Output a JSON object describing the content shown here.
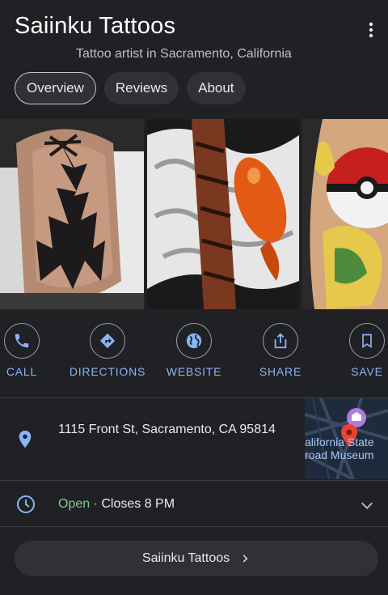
{
  "header": {
    "title": "Saiinku Tattoos",
    "subtitle": "Tattoo artist in Sacramento, California"
  },
  "tabs": [
    {
      "label": "Overview",
      "active": true
    },
    {
      "label": "Reviews",
      "active": false
    },
    {
      "label": "About",
      "active": false
    }
  ],
  "actions": [
    {
      "label": "CALL",
      "icon": "phone-icon"
    },
    {
      "label": "DIRECTIONS",
      "icon": "directions-icon"
    },
    {
      "label": "WEBSITE",
      "icon": "globe-icon"
    },
    {
      "label": "SHARE",
      "icon": "share-icon"
    },
    {
      "label": "SAVE",
      "icon": "bookmark-icon"
    }
  ],
  "address": {
    "text": "1115 Front St, Sacramento, CA 95814",
    "map_label_line1": "alifornia State",
    "map_label_line2": "road Museum"
  },
  "hours": {
    "status": "Open",
    "separator": " · ",
    "closes": "Closes 8 PM"
  },
  "website_button": {
    "label": "Saiinku Tattoos"
  },
  "colors": {
    "background": "#202124",
    "accent": "#8ab4f8",
    "open": "#81c995",
    "map_pin": "#ea4335"
  }
}
